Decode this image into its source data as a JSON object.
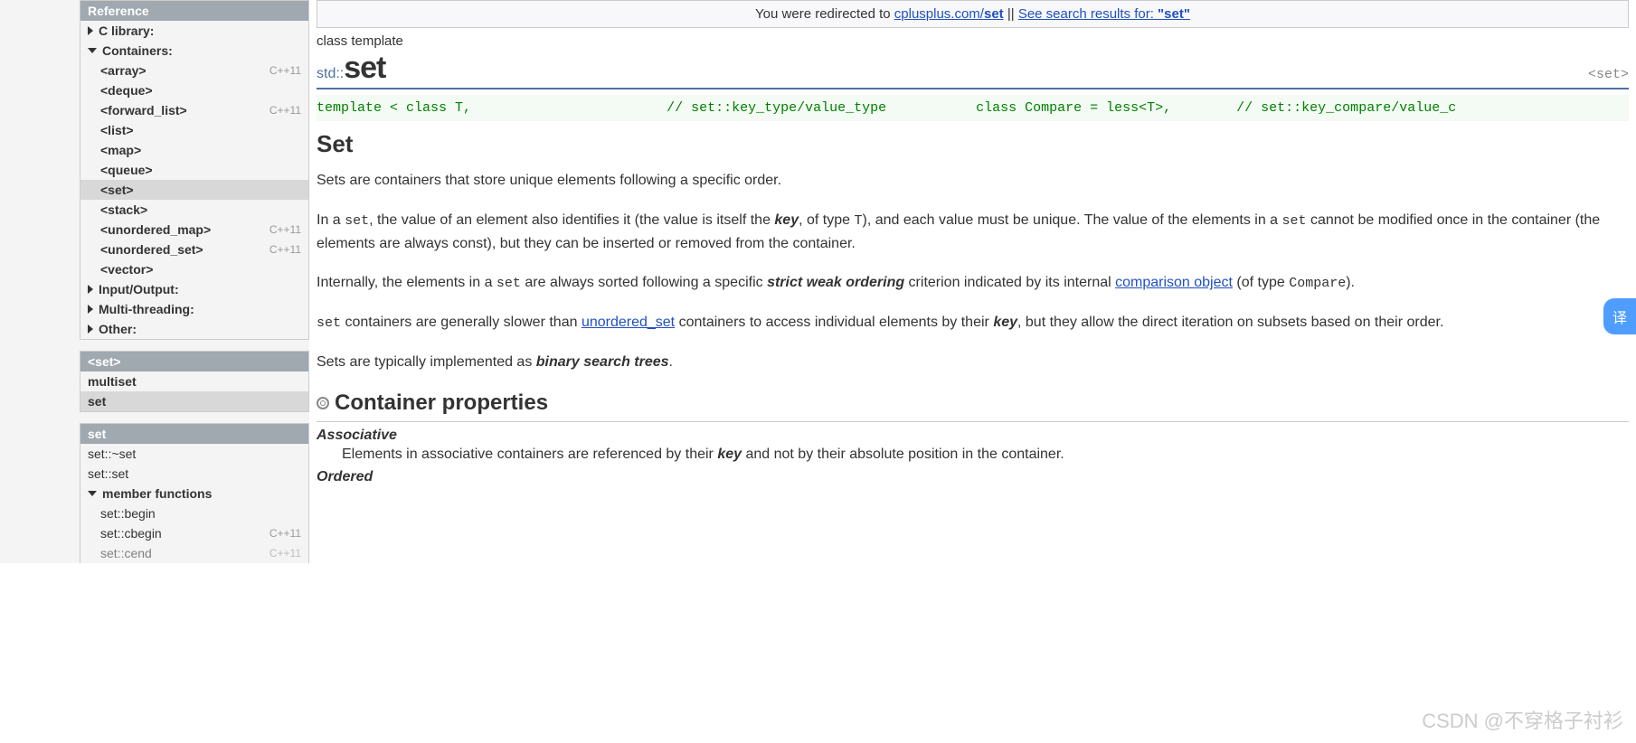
{
  "sidebar": {
    "reference_header": "Reference",
    "sections": {
      "c_library": "C library:",
      "containers": "Containers:",
      "io": "Input/Output:",
      "mt": "Multi-threading:",
      "other": "Other:"
    },
    "containers": [
      {
        "label": "<array>",
        "badge": "C++11"
      },
      {
        "label": "<deque>"
      },
      {
        "label": "<forward_list>",
        "badge": "C++11"
      },
      {
        "label": "<list>"
      },
      {
        "label": "<map>"
      },
      {
        "label": "<queue>"
      },
      {
        "label": "<set>",
        "active": true
      },
      {
        "label": "<stack>"
      },
      {
        "label": "<unordered_map>",
        "badge": "C++11"
      },
      {
        "label": "<unordered_set>",
        "badge": "C++11"
      },
      {
        "label": "<vector>"
      }
    ],
    "set_header": "<set>",
    "set_items": [
      {
        "label": "multiset"
      },
      {
        "label": "set",
        "active": true
      }
    ],
    "members_header": "set",
    "members": [
      {
        "label": "set::~set"
      },
      {
        "label": "set::set"
      }
    ],
    "member_functions_label": "member functions",
    "member_functions": [
      {
        "label": "set::begin"
      },
      {
        "label": "set::cbegin",
        "badge": "C++11"
      },
      {
        "label": "set::cend",
        "badge": "C++11"
      }
    ]
  },
  "redirect": {
    "prefix": "You were redirected to ",
    "link1_a": "cplusplus.com/",
    "link1_b": "set",
    "sep": " || ",
    "link2_a": "See search results for: ",
    "link2_b": "\"set\""
  },
  "subtitle": "class template",
  "namespace": "std::",
  "title": "set",
  "header_tag": "<set>",
  "template_code": "template < class T,                        // set::key_type/value_type           class Compare = less<T>,        // set::key_compare/value_c",
  "section_heading": "Set",
  "para1": "Sets are containers that store unique elements following a specific order.",
  "para2_a": "In a ",
  "para2_set": "set",
  "para2_b": ", the value of an element also identifies it (the value is itself the ",
  "para2_key": "key",
  "para2_c": ", of type ",
  "para2_T": "T",
  "para2_d": "), and each value must be unique. The value of the elements in a ",
  "para2_set2": "set",
  "para2_e": " cannot be modified once in the container (the elements are always const), but they can be inserted or removed from the container.",
  "para3_a": "Internally, the elements in a ",
  "para3_set": "set",
  "para3_b": " are always sorted following a specific ",
  "para3_strict": "strict weak ordering",
  "para3_c": " criterion indicated by its internal ",
  "para3_link": "comparison object",
  "para3_d": " (of type ",
  "para3_compare": "Compare",
  "para3_e": ").",
  "para4_set": "set",
  "para4_a": " containers are generally slower than ",
  "para4_link": "unordered_set",
  "para4_b": " containers to access individual elements by their ",
  "para4_key": "key",
  "para4_c": ", but they allow the direct iteration on subsets based on their order.",
  "para5_a": "Sets are typically implemented as ",
  "para5_b": "binary search trees",
  "para5_c": ".",
  "props_heading": "Container properties",
  "prop1_term": "Associative",
  "prop1_def_a": "Elements in associative containers are referenced by their ",
  "prop1_def_key": "key",
  "prop1_def_b": " and not by their absolute position in the container.",
  "prop2_term": "Ordered",
  "translate_btn": "译",
  "watermark": "CSDN @不穿格子衬衫"
}
